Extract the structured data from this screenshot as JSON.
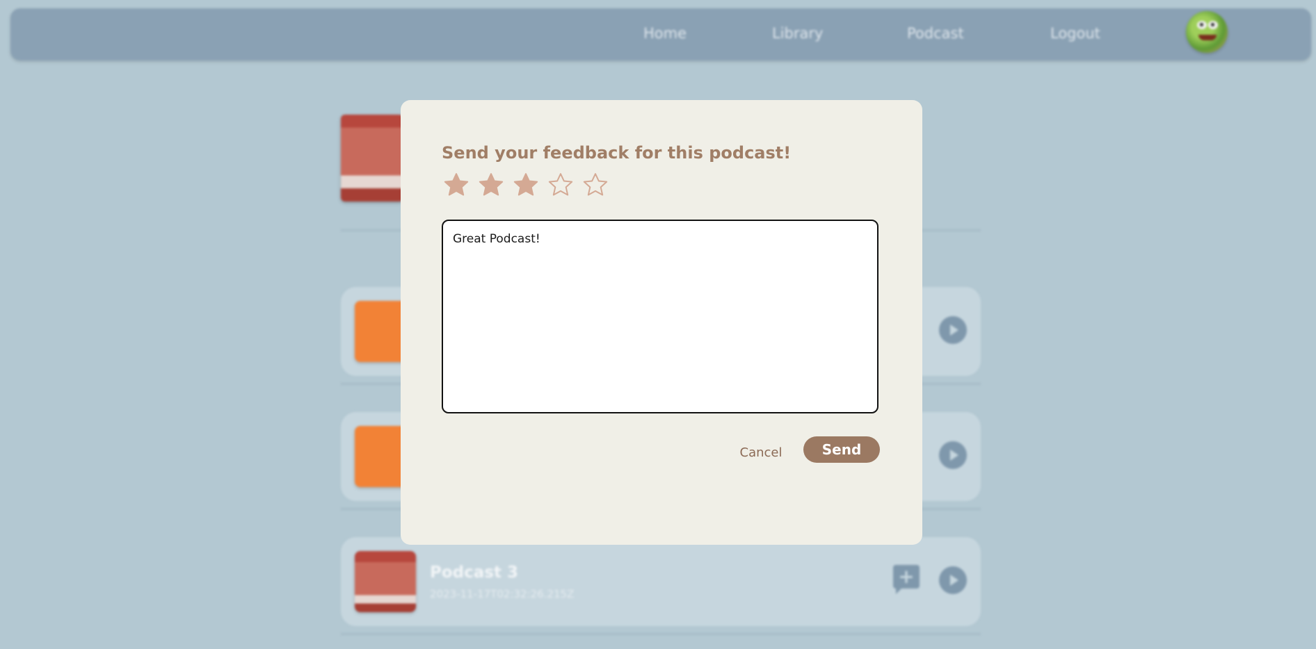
{
  "nav": {
    "items": [
      {
        "label": "Home"
      },
      {
        "label": "Library"
      },
      {
        "label": "Podcast"
      },
      {
        "label": "Logout"
      }
    ],
    "avatar_icon": "kermit-avatar-icon"
  },
  "list": {
    "items": [
      {
        "title": "",
        "date": "",
        "art": "orange"
      },
      {
        "title": "",
        "date": "",
        "art": "orange"
      },
      {
        "title": "Podcast 3",
        "date": "2023-11-17T02:32:26.215Z",
        "art": "red"
      }
    ],
    "play_icon": "play-icon",
    "add_comment_icon": "add-comment-icon"
  },
  "modal": {
    "title": "Send your feedback for this podcast!",
    "rating": 3,
    "max_rating": 5,
    "feedback_value": "Great Podcast!",
    "cancel_label": "Cancel",
    "send_label": "Send"
  },
  "colors": {
    "background": "#b3c8d2",
    "navbar": "#8aa1b4",
    "modal": "#f0efe7",
    "accent": "#9b7962",
    "star_fill": "#d4a994"
  }
}
